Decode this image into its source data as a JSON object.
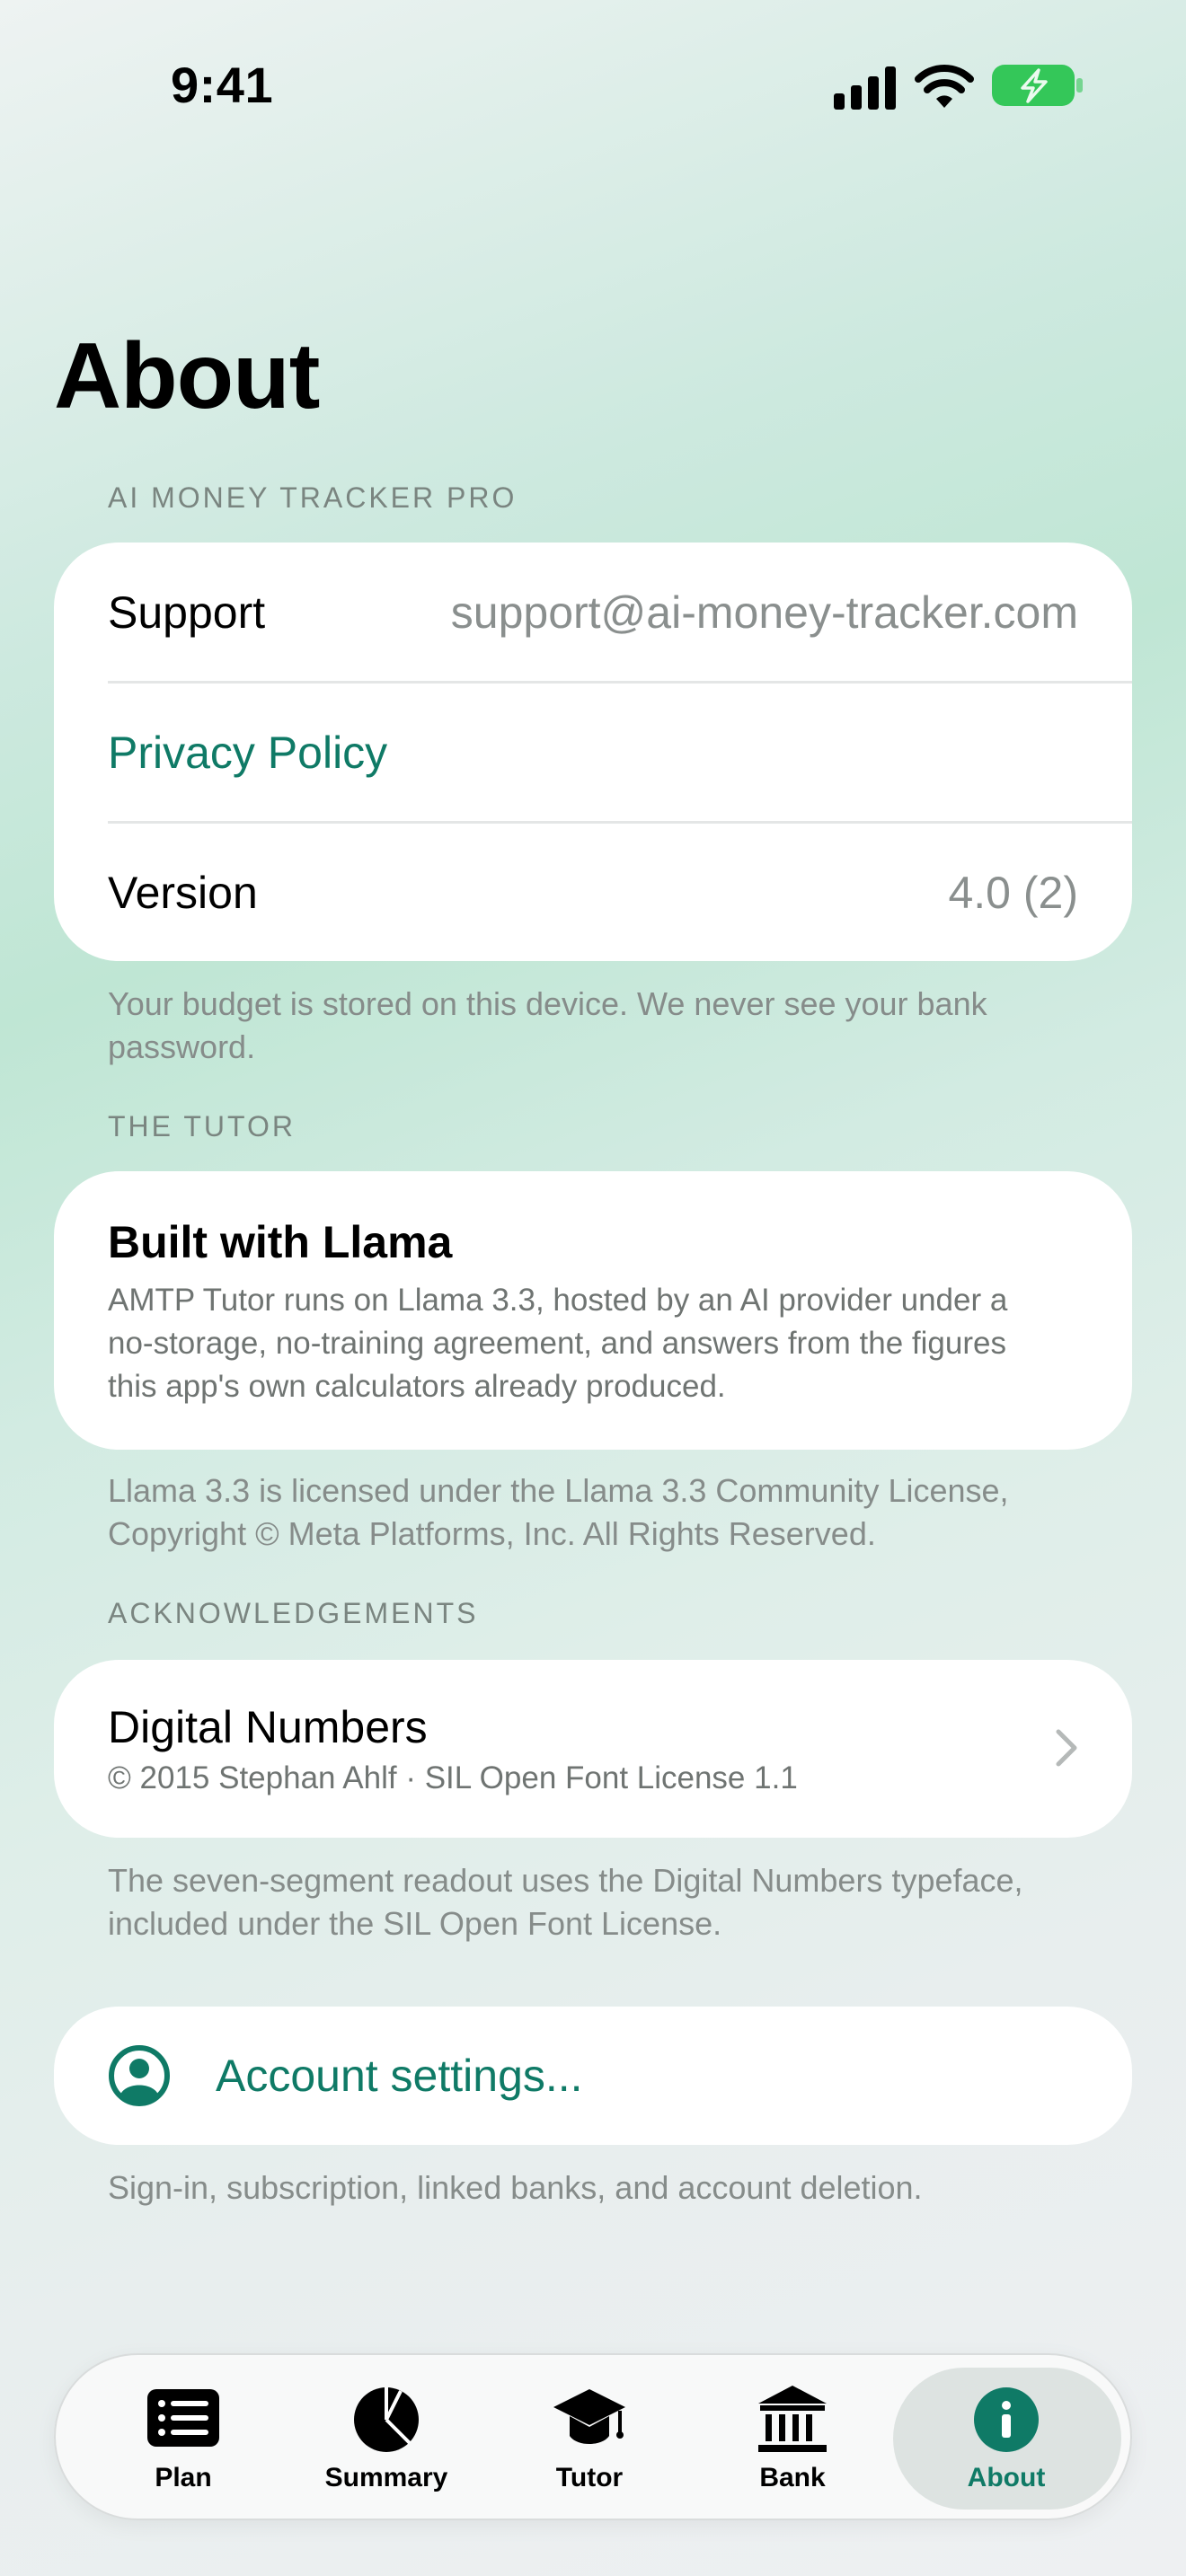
{
  "status_bar": {
    "time": "9:41"
  },
  "page": {
    "title": "About"
  },
  "app_section": {
    "header": "AI MONEY TRACKER PRO",
    "support_label": "Support",
    "support_value": "support@ai-money-tracker.com",
    "privacy_label": "Privacy Policy",
    "version_label": "Version",
    "version_value": "4.0 (2)",
    "footnote": "Your budget is stored on this device. We never see your bank password."
  },
  "tutor_section": {
    "header": "THE TUTOR",
    "title": "Built with Llama",
    "body": "AMTP Tutor runs on Llama 3.3, hosted by an AI provider under a no-storage, no-training agreement, and answers from the figures this app's own calculators already produced.",
    "footnote": "Llama 3.3 is licensed under the Llama 3.3 Community License, Copyright © Meta Platforms, Inc. All Rights Reserved."
  },
  "ack_section": {
    "header": "ACKNOWLEDGEMENTS",
    "title": "Digital Numbers",
    "subtitle": "© 2015 Stephan Ahlf · SIL Open Font License 1.1",
    "footnote": "The seven-segment readout uses the Digital Numbers typeface, included under the SIL Open Font License."
  },
  "account": {
    "label": "Account settings...",
    "footnote": "Sign-in, subscription, linked banks, and account deletion."
  },
  "tabs": [
    {
      "label": "Plan",
      "icon": "list-icon"
    },
    {
      "label": "Summary",
      "icon": "pie-chart-icon"
    },
    {
      "label": "Tutor",
      "icon": "graduation-cap-icon"
    },
    {
      "label": "Bank",
      "icon": "bank-icon"
    },
    {
      "label": "About",
      "icon": "info-icon",
      "active": true
    }
  ],
  "colors": {
    "accent": "#0f7a66",
    "battery": "#34c759"
  }
}
